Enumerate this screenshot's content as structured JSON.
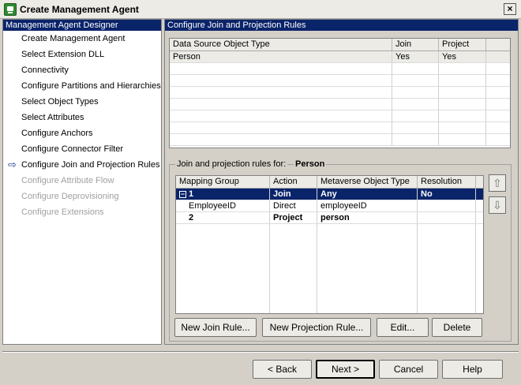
{
  "window": {
    "title": "Create Management Agent",
    "close_glyph": "×"
  },
  "sidebar": {
    "header": "Management Agent Designer",
    "items": [
      {
        "label": "Create Management Agent"
      },
      {
        "label": "Select Extension DLL"
      },
      {
        "label": "Connectivity"
      },
      {
        "label": "Configure Partitions and Hierarchies"
      },
      {
        "label": "Select Object Types"
      },
      {
        "label": "Select Attributes"
      },
      {
        "label": "Configure Anchors"
      },
      {
        "label": "Configure Connector Filter"
      },
      {
        "label": "Configure Join and Projection Rules",
        "current": true
      },
      {
        "label": "Configure Attribute Flow",
        "disabled": true
      },
      {
        "label": "Configure Deprovisioning",
        "disabled": true
      },
      {
        "label": "Configure Extensions",
        "disabled": true
      }
    ]
  },
  "main": {
    "header": "Configure Join and Projection Rules",
    "object_grid": {
      "columns": [
        "Data Source Object Type",
        "Join",
        "Project"
      ],
      "rows": [
        [
          "Person",
          "Yes",
          "Yes"
        ]
      ]
    },
    "rules_label": "Join and projection rules for:",
    "rules_object": "Person",
    "rules_grid": {
      "columns": [
        "Mapping Group",
        "Action",
        "Metaverse Object Type",
        "Resolution"
      ],
      "rows": [
        {
          "cells": [
            "1",
            "Join",
            "Any",
            "No"
          ],
          "selected": true,
          "bold": true,
          "expander": "−"
        },
        {
          "cells": [
            "EmployeeID",
            "Direct",
            "employeeID",
            ""
          ]
        },
        {
          "cells": [
            "2",
            "Project",
            "person",
            ""
          ],
          "bold": true
        }
      ]
    },
    "move_up_glyph": "⇧",
    "move_down_glyph": "⇩",
    "buttons": {
      "new_join_rule": "New Join Rule...",
      "new_projection_rule": "New Projection Rule...",
      "edit": "Edit...",
      "delete": "Delete"
    }
  },
  "footer": {
    "back": "< Back",
    "next": "Next >",
    "cancel": "Cancel",
    "help": "Help"
  },
  "icons": {
    "current_step": "arrow-right-icon",
    "app": "management-agent-icon"
  },
  "colors": {
    "header_bg": "#0a246a",
    "selection_bg": "#0a246a",
    "window_bg": "#d4d0c8"
  }
}
